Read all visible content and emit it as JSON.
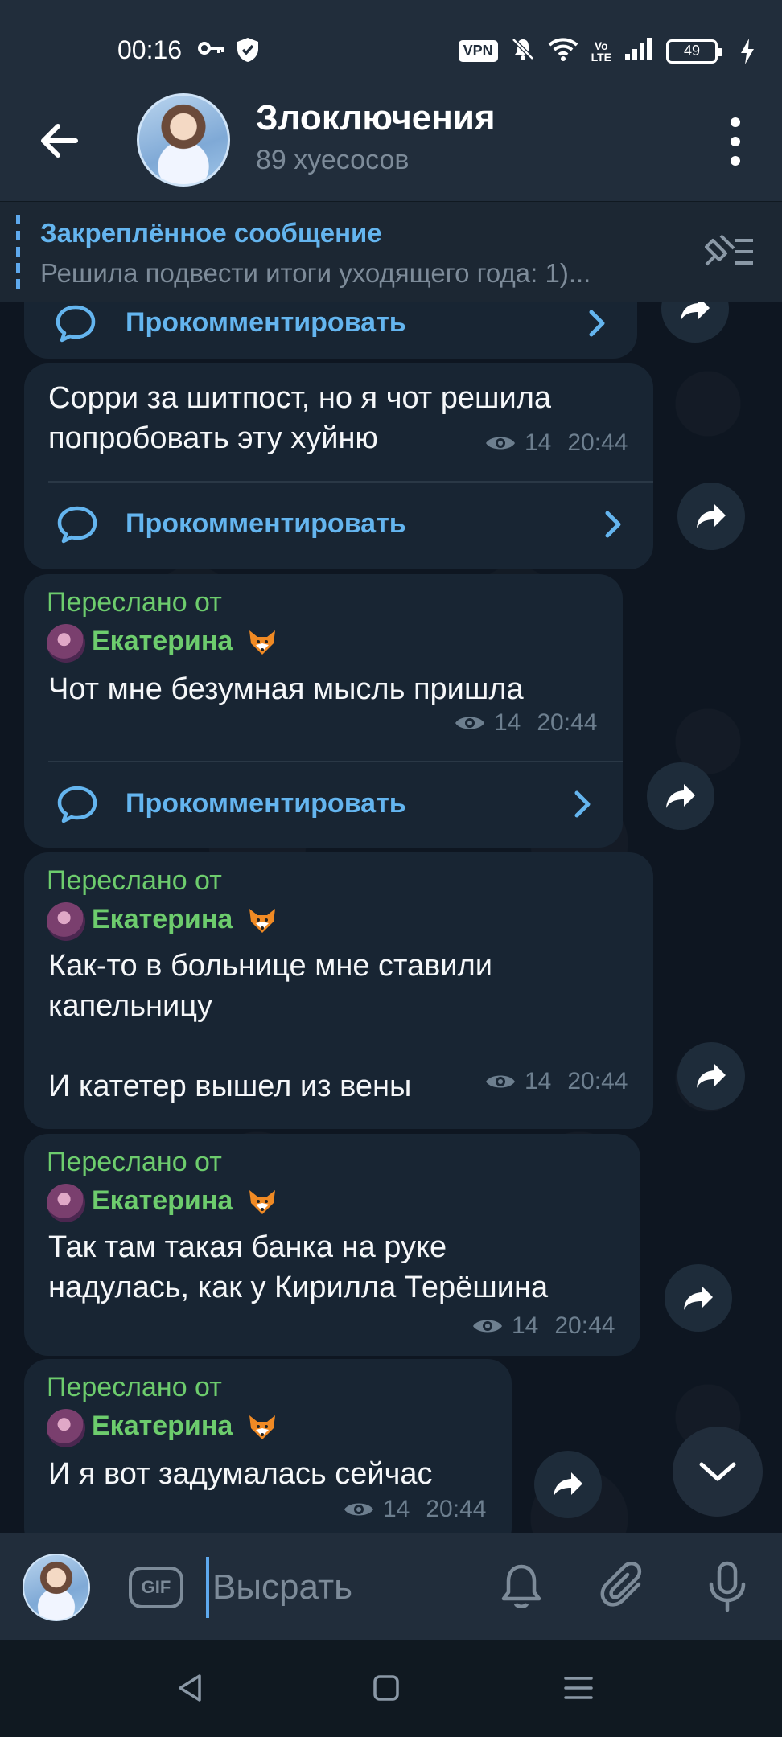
{
  "status_bar": {
    "time": "00:16",
    "vpn": "VPN",
    "volte": "Vo\nLTE",
    "battery": "49"
  },
  "header": {
    "title": "Злоключения",
    "subtitle": "89 хуесосов"
  },
  "pinned": {
    "title": "Закреплённое сообщение",
    "text": "Решила подвести итоги уходящего  года:  1)..."
  },
  "messages": [
    {
      "comment_label": "Прокомментировать"
    },
    {
      "text": "Сорри за шитпост, но я чот решила\nпопробовать эту хуйню",
      "views": "14",
      "time": "20:44",
      "comment_label": "Прокомментировать"
    },
    {
      "forwarded_label": "Переслано от",
      "forwarded_name": "Екатерина",
      "text": "Чот мне безумная мысль пришла",
      "views": "14",
      "time": "20:44",
      "comment_label": "Прокомментировать"
    },
    {
      "forwarded_label": "Переслано от",
      "forwarded_name": "Екатерина",
      "text": "Как-то в больнице мне ставили\nкапельницу\n\nИ катетер вышел из вены",
      "views": "14",
      "time": "20:44"
    },
    {
      "forwarded_label": "Переслано от",
      "forwarded_name": "Екатерина",
      "text": "Так там такая банка на руке\nнадулась, как у Кирилла Терёшина",
      "views": "14",
      "time": "20:44"
    },
    {
      "forwarded_label": "Переслано от",
      "forwarded_name": "Екатерина",
      "text": "И я вот задумалась сейчас",
      "views": "14",
      "time": "20:44"
    }
  ],
  "composer": {
    "gif_label": "GIF",
    "placeholder": "Высрать"
  },
  "colors": {
    "accent": "#64b5ef",
    "forward_green": "#6dcc6d",
    "bubble": "#182533",
    "header": "#212d3b",
    "background": "#0e1621"
  }
}
